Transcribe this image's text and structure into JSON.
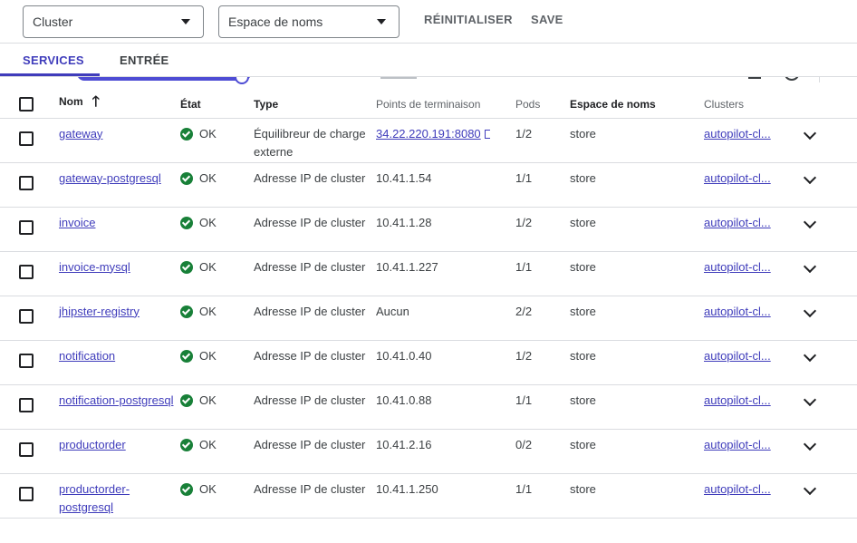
{
  "filters": {
    "cluster_placeholder": "Cluster",
    "namespace_placeholder": "Espace de noms",
    "reset_label": "RÉINITIALISER",
    "save_label": "SAVE"
  },
  "tabs": [
    {
      "label": "SERVICES",
      "active": true
    },
    {
      "label": "ENTRÉE",
      "active": false
    }
  ],
  "table": {
    "headers": {
      "name": "Nom",
      "status": "État",
      "type": "Type",
      "endpoints": "Points de terminaison",
      "pods": "Pods",
      "namespace": "Espace de noms",
      "clusters": "Clusters"
    },
    "rows": [
      {
        "name": "gateway",
        "status": "OK",
        "type": "Équilibreur de charge externe",
        "endpoint": "34.22.220.191:8080",
        "endpoint_link": true,
        "pods": "1/2",
        "namespace": "store",
        "cluster": "autopilot-cl..."
      },
      {
        "name": "gateway-postgresql",
        "status": "OK",
        "type": "Adresse IP de cluster",
        "endpoint": "10.41.1.54",
        "endpoint_link": false,
        "pods": "1/1",
        "namespace": "store",
        "cluster": "autopilot-cl..."
      },
      {
        "name": "invoice",
        "status": "OK",
        "type": "Adresse IP de cluster",
        "endpoint": "10.41.1.28",
        "endpoint_link": false,
        "pods": "1/2",
        "namespace": "store",
        "cluster": "autopilot-cl..."
      },
      {
        "name": "invoice-mysql",
        "status": "OK",
        "type": "Adresse IP de cluster",
        "endpoint": "10.41.1.227",
        "endpoint_link": false,
        "pods": "1/1",
        "namespace": "store",
        "cluster": "autopilot-cl..."
      },
      {
        "name": "jhipster-registry",
        "status": "OK",
        "type": "Adresse IP de cluster",
        "endpoint": "Aucun",
        "endpoint_link": false,
        "pods": "2/2",
        "namespace": "store",
        "cluster": "autopilot-cl..."
      },
      {
        "name": "notification",
        "status": "OK",
        "type": "Adresse IP de cluster",
        "endpoint": "10.41.0.40",
        "endpoint_link": false,
        "pods": "1/2",
        "namespace": "store",
        "cluster": "autopilot-cl..."
      },
      {
        "name": "notification-postgresql",
        "status": "OK",
        "type": "Adresse IP de cluster",
        "endpoint": "10.41.0.88",
        "endpoint_link": false,
        "pods": "1/1",
        "namespace": "store",
        "cluster": "autopilot-cl..."
      },
      {
        "name": "productorder",
        "status": "OK",
        "type": "Adresse IP de cluster",
        "endpoint": "10.41.2.16",
        "endpoint_link": false,
        "pods": "0/2",
        "namespace": "store",
        "cluster": "autopilot-cl..."
      },
      {
        "name": "productorder-postgresql",
        "status": "OK",
        "type": "Adresse IP de cluster",
        "endpoint": "10.41.1.250",
        "endpoint_link": false,
        "pods": "1/1",
        "namespace": "store",
        "cluster": "autopilot-cl..."
      }
    ]
  },
  "colors": {
    "accent": "#3f3cbb",
    "ok": "#188038"
  },
  "icons": {
    "sort": "arrow-up-icon",
    "expand": "chevron-down-icon",
    "status_ok": "check-circle-icon"
  }
}
